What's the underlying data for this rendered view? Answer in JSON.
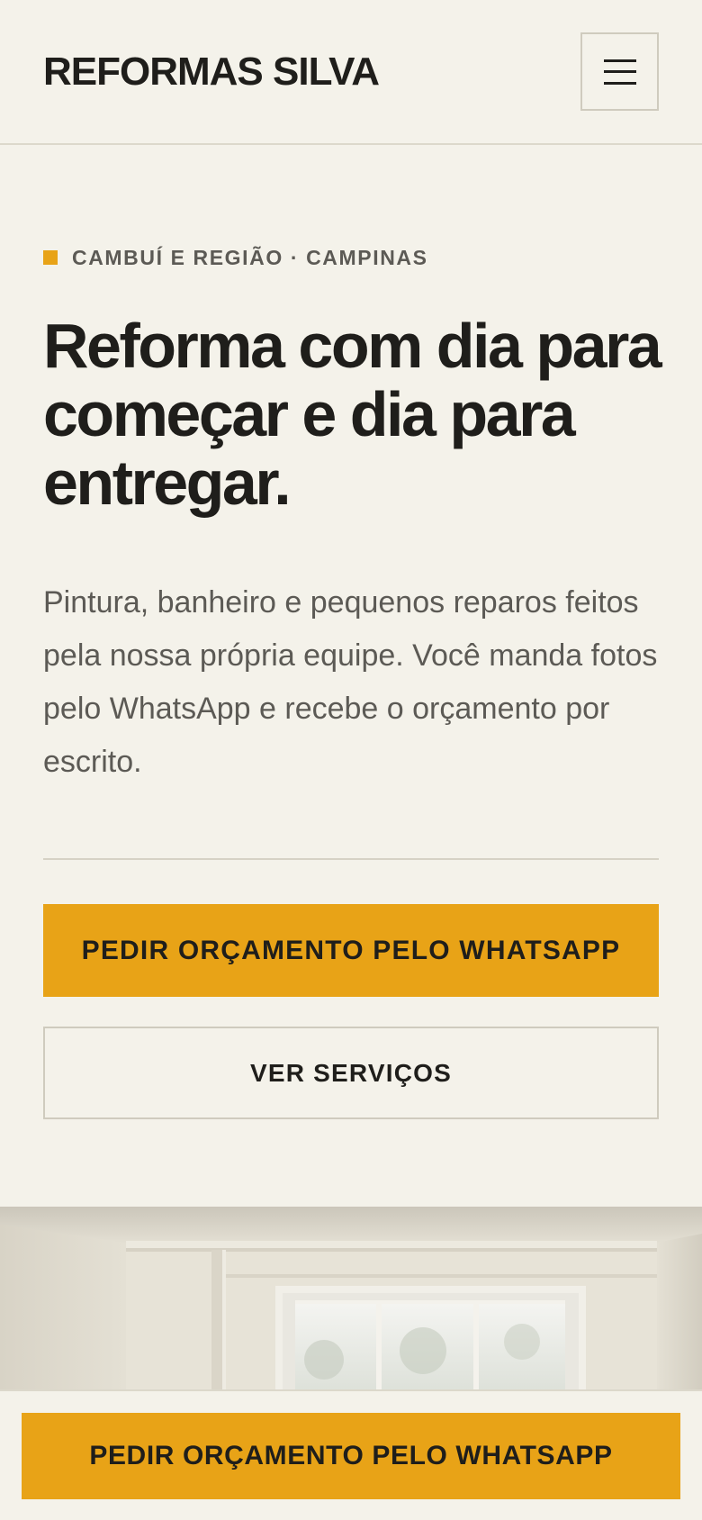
{
  "header": {
    "brand": "REFORMAS SILVA",
    "menu_icon": "hamburger-menu-icon"
  },
  "hero": {
    "eyebrow": "CAMBUÍ E REGIÃO · CAMPINAS",
    "headline": "Reforma com dia para começar e dia para entregar.",
    "lead": "Pintura, banheiro e pequenos reparos feitos pela nossa própria equipe. Você manda fotos pelo WhatsApp e recebe o orçamento por escrito.",
    "primary_cta": "PEDIR ORÇAMENTO PELO WHATSAPP",
    "secondary_cta": "VER SERVIÇOS"
  },
  "sticky_cta": {
    "label": "PEDIR ORÇAMENTO PELO WHATSAPP"
  },
  "colors": {
    "background": "#F4F2EA",
    "accent": "#E8A317",
    "text": "#1F1E1B",
    "muted_text": "#5C5A55",
    "border": "#CFCBBE"
  }
}
